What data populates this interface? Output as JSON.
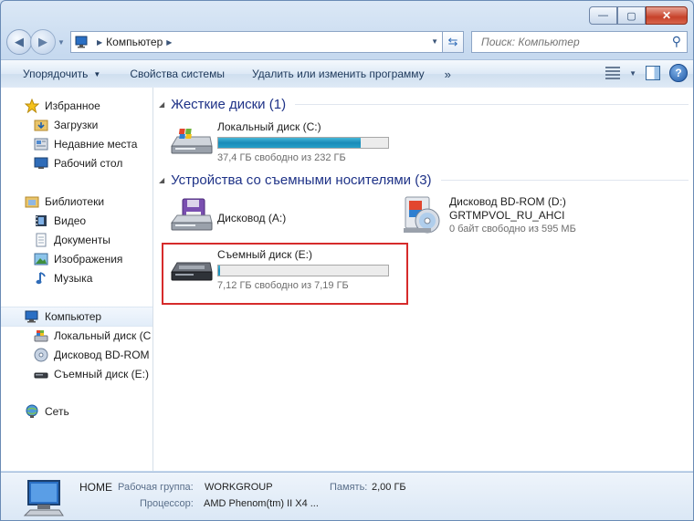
{
  "window": {
    "caption": {
      "minimize": "—",
      "maximize": "▢",
      "close": "✕"
    }
  },
  "address": {
    "crumb": "Компьютер",
    "search_placeholder": "Поиск: Компьютер"
  },
  "toolbar": {
    "organize": "Упорядочить",
    "system_properties": "Свойства системы",
    "uninstall": "Удалить или изменить программу",
    "more": "»"
  },
  "nav": {
    "favorites": "Избранное",
    "downloads": "Загрузки",
    "recent": "Недавние места",
    "desktop": "Рабочий стол",
    "libraries": "Библиотеки",
    "video": "Видео",
    "documents": "Документы",
    "pictures": "Изображения",
    "music": "Музыка",
    "computer": "Компьютер",
    "local_c": "Локальный диск (C",
    "bd_rom": "Дисковод BD-ROM",
    "removable_e": "Съемный диск (E:)",
    "network": "Сеть"
  },
  "groups": {
    "hard_disks": "Жесткие диски (1)",
    "removable": "Устройства со съемными носителями (3)"
  },
  "drives": {
    "c": {
      "name": "Локальный диск (C:)",
      "free": "37,4 ГБ свободно из 232 ГБ",
      "used_fraction": 0.84
    },
    "a": {
      "name": "Дисковод (A:)"
    },
    "d": {
      "name": "Дисковод BD-ROM (D:)",
      "label": "GRTMPVOL_RU_AHCI",
      "free": "0 байт свободно из 595 МБ"
    },
    "e": {
      "name": "Съемный диск (E:)",
      "free": "7,12 ГБ свободно из 7,19 ГБ",
      "used_fraction": 0.01
    }
  },
  "details": {
    "hostname": "HOME",
    "workgroup_label": "Рабочая группа:",
    "workgroup": "WORKGROUP",
    "memory_label": "Память:",
    "memory": "2,00 ГБ",
    "cpu_label": "Процессор:",
    "cpu": "AMD Phenom(tm) II X4 ..."
  },
  "colors": {
    "highlight_border": "#d62b2b",
    "bar_fill": "#1a8bb8"
  }
}
